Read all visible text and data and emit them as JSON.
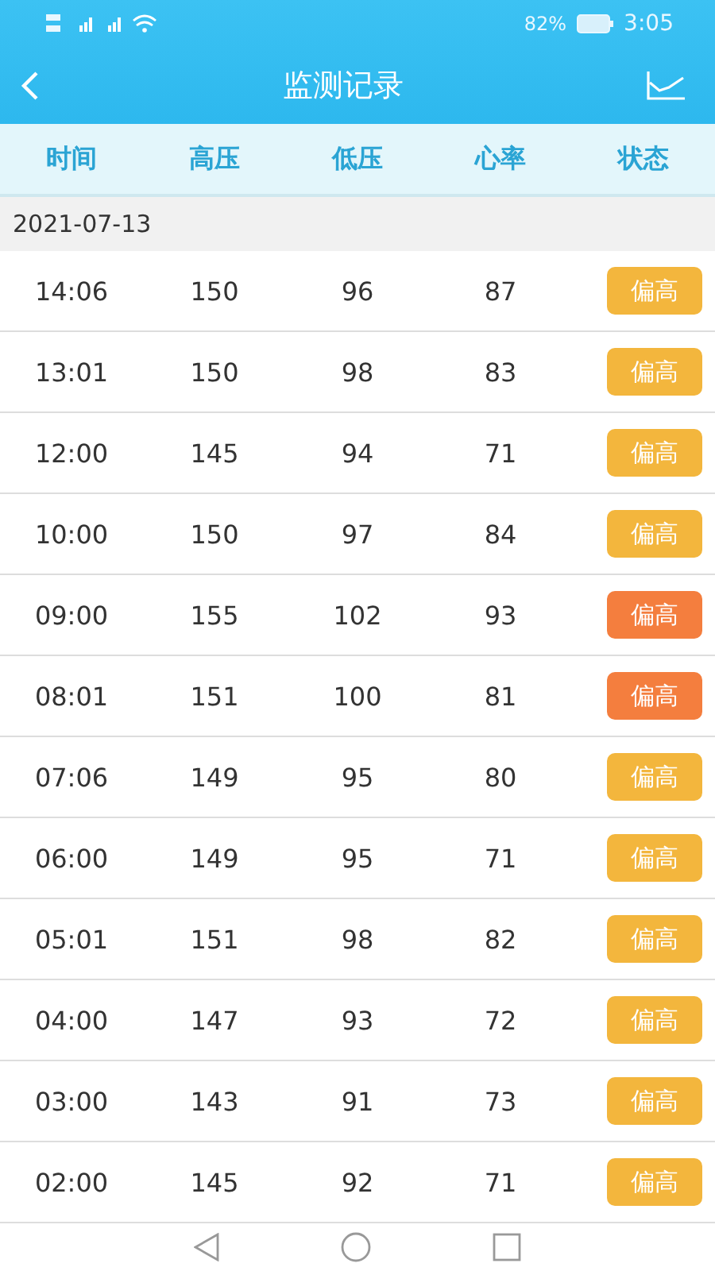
{
  "status_bar": {
    "battery_text": "82%",
    "time": "3:05"
  },
  "header": {
    "title": "监测记录"
  },
  "columns": [
    "时间",
    "高压",
    "低压",
    "心率",
    "状态"
  ],
  "date": "2021-07-13",
  "rows": [
    {
      "time": "14:06",
      "systolic": "150",
      "diastolic": "96",
      "heart_rate": "87",
      "status": "偏高",
      "color": "#f3b63d"
    },
    {
      "time": "13:01",
      "systolic": "150",
      "diastolic": "98",
      "heart_rate": "83",
      "status": "偏高",
      "color": "#f3b63d"
    },
    {
      "time": "12:00",
      "systolic": "145",
      "diastolic": "94",
      "heart_rate": "71",
      "status": "偏高",
      "color": "#f3b63d"
    },
    {
      "time": "10:00",
      "systolic": "150",
      "diastolic": "97",
      "heart_rate": "84",
      "status": "偏高",
      "color": "#f3b63d"
    },
    {
      "time": "09:00",
      "systolic": "155",
      "diastolic": "102",
      "heart_rate": "93",
      "status": "偏高",
      "color": "#f47e3e"
    },
    {
      "time": "08:01",
      "systolic": "151",
      "diastolic": "100",
      "heart_rate": "81",
      "status": "偏高",
      "color": "#f47e3e"
    },
    {
      "time": "07:06",
      "systolic": "149",
      "diastolic": "95",
      "heart_rate": "80",
      "status": "偏高",
      "color": "#f3b63d"
    },
    {
      "time": "06:00",
      "systolic": "149",
      "diastolic": "95",
      "heart_rate": "71",
      "status": "偏高",
      "color": "#f3b63d"
    },
    {
      "time": "05:01",
      "systolic": "151",
      "diastolic": "98",
      "heart_rate": "82",
      "status": "偏高",
      "color": "#f3b63d"
    },
    {
      "time": "04:00",
      "systolic": "147",
      "diastolic": "93",
      "heart_rate": "72",
      "status": "偏高",
      "color": "#f3b63d"
    },
    {
      "time": "03:00",
      "systolic": "143",
      "diastolic": "91",
      "heart_rate": "73",
      "status": "偏高",
      "color": "#f3b63d"
    },
    {
      "time": "02:00",
      "systolic": "145",
      "diastolic": "92",
      "heart_rate": "71",
      "status": "偏高",
      "color": "#f3b63d"
    }
  ]
}
